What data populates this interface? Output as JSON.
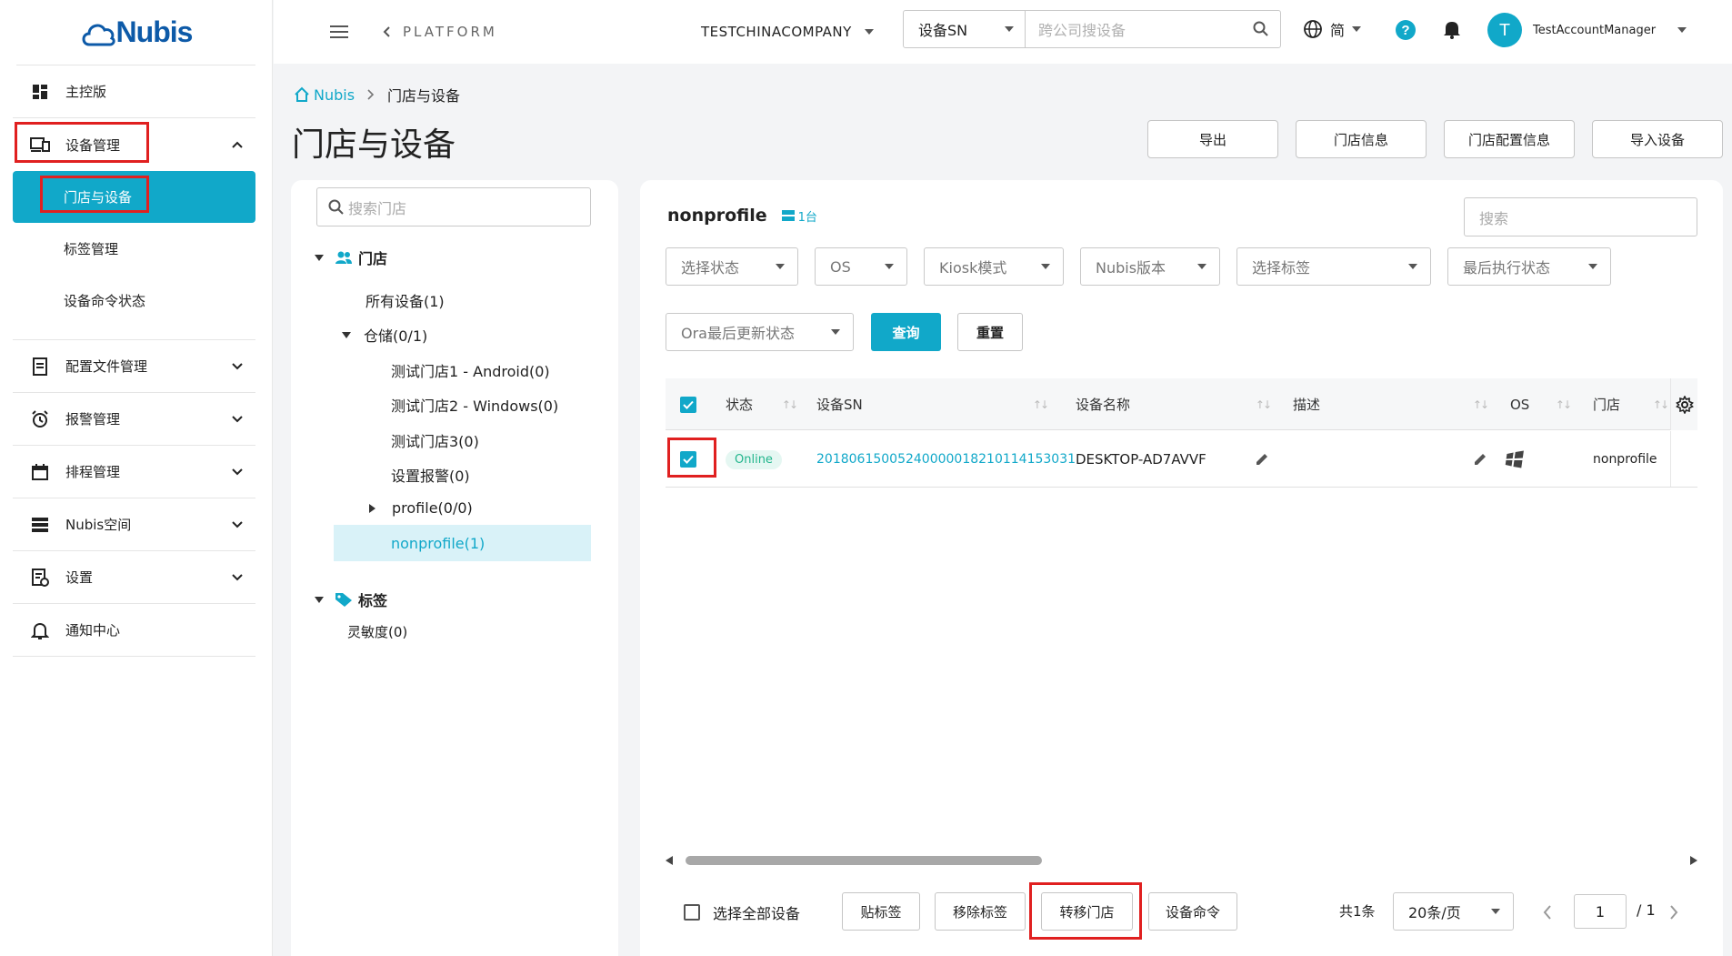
{
  "logo": {
    "text": "Nubis"
  },
  "sidebar": {
    "items": [
      {
        "label": "主控版",
        "icon": "dashboard-icon"
      },
      {
        "label": "设备管理",
        "icon": "devices-icon",
        "expanded": true,
        "children": [
          {
            "label": "门店与设备",
            "active": true
          },
          {
            "label": "标签管理"
          },
          {
            "label": "设备命令状态"
          }
        ]
      },
      {
        "label": "配置文件管理",
        "icon": "config-file-icon"
      },
      {
        "label": "报警管理",
        "icon": "alarm-clock-icon"
      },
      {
        "label": "排程管理",
        "icon": "calendar-icon"
      },
      {
        "label": "Nubis空间",
        "icon": "storage-icon"
      },
      {
        "label": "设置",
        "icon": "settings-doc-icon"
      },
      {
        "label": "通知中心",
        "icon": "bell-outline-icon"
      }
    ]
  },
  "topbar": {
    "platform": "PLATFORM",
    "company": "TESTCHINACOMPANY",
    "search_select": "设备SN",
    "search_placeholder": "跨公司搜设备",
    "lang": "简",
    "user_initial": "T",
    "user_name": "TestAccountManager"
  },
  "breadcrumb": {
    "home": "Nubis",
    "current": "门店与设备"
  },
  "page_title": "门店与设备",
  "header_buttons": [
    "导出",
    "门店信息",
    "门店配置信息",
    "导入设备"
  ],
  "tree": {
    "search_placeholder": "搜索门店",
    "stores_label": "门店",
    "nodes": {
      "all": "所有设备(1)",
      "warehouse": "仓储(0/1)",
      "store1": "测试门店1 - Android(0)",
      "store2": "测试门店2 - Windows(0)",
      "store3": "测试门店3(0)",
      "alarm": "设置报警(0)",
      "profile": "profile(0/0)",
      "nonprofile": "nonprofile(1)"
    },
    "tags_label": "标签",
    "tag_items": [
      "灵敏度(0)"
    ]
  },
  "main": {
    "title": "nonprofile",
    "count": "1台",
    "search_placeholder": "搜索",
    "filters": {
      "status": "选择状态",
      "os": "OS",
      "kiosk": "Kiosk模式",
      "nubis_version": "Nubis版本",
      "tag": "选择标签",
      "last_exec": "最后执行状态",
      "ora": "Ora最后更新状态"
    },
    "query_btn": "查询",
    "reset_btn": "重置",
    "table": {
      "headers": {
        "status": "状态",
        "sn": "设备SN",
        "name": "设备名称",
        "desc": "描述",
        "os": "OS",
        "store": "门店"
      },
      "rows": [
        {
          "status": "Online",
          "sn": "20180615005240000018210114153031",
          "name": "DESKTOP-AD7AVVF",
          "store": "nonprofile"
        }
      ]
    },
    "footer": {
      "select_all": "选择全部设备",
      "btn_tag": "贴标签",
      "btn_remove_tag": "移除标签",
      "btn_transfer": "转移门店",
      "btn_command": "设备命令",
      "total": "共1条",
      "page_size": "20条/页",
      "page": "1",
      "page_total": "/ 1"
    }
  },
  "colors": {
    "accent": "#11a8c9",
    "highlight_box": "#e02020",
    "online": "#21b58c"
  }
}
